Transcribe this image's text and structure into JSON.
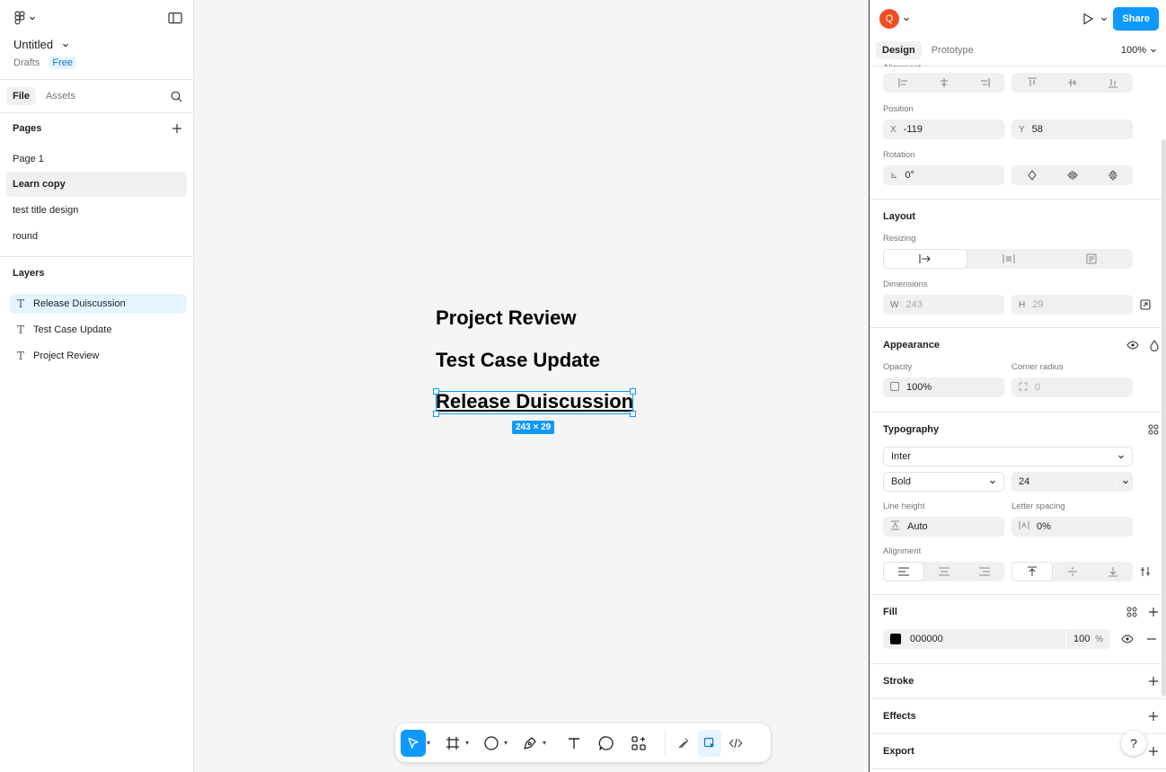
{
  "file": {
    "title": "Untitled",
    "location": "Drafts",
    "plan": "Free"
  },
  "left_tabs": {
    "file": "File",
    "assets": "Assets"
  },
  "pages": {
    "header": "Pages",
    "items": [
      "Page 1",
      "Learn copy",
      "test  title design",
      "round"
    ],
    "active": "Learn copy"
  },
  "layers": {
    "header": "Layers",
    "items": [
      "Release Duiscussion",
      "Test Case Update",
      "Project Review"
    ],
    "selected": "Release Duiscussion"
  },
  "canvas": {
    "texts": [
      "Project Review",
      "Test Case Update",
      "Release Duiscussion"
    ],
    "selection_size": "243 × 29"
  },
  "right_top": {
    "avatar": "Q",
    "share": "Share"
  },
  "right_tabs": {
    "design": "Design",
    "prototype": "Prototype",
    "zoom": "100%"
  },
  "transform": {
    "alignment_label": "Alignment",
    "position_label": "Position",
    "x_label": "X",
    "x": "-119",
    "y_label": "Y",
    "y": "58",
    "rotation_label": "Rotation",
    "rotation": "0°"
  },
  "layout": {
    "title": "Layout",
    "resizing_label": "Resizing",
    "dimensions_label": "Dimensions",
    "w_label": "W",
    "w": "243",
    "h_label": "H",
    "h": "29"
  },
  "appearance": {
    "title": "Appearance",
    "opacity_label": "Opacity",
    "opacity": "100%",
    "radius_label": "Corner radius",
    "radius": "0"
  },
  "typography": {
    "title": "Typography",
    "font": "Inter",
    "weight": "Bold",
    "size": "24",
    "line_height_label": "Line height",
    "line_height": "Auto",
    "letter_spacing_label": "Letter spacing",
    "letter_spacing": "0%",
    "alignment_label": "Alignment"
  },
  "fill": {
    "title": "Fill",
    "hex": "000000",
    "opacity": "100",
    "unit": "%",
    "swatch": "#000000"
  },
  "stroke": {
    "title": "Stroke"
  },
  "effects": {
    "title": "Effects"
  },
  "export": {
    "title": "Export"
  },
  "help": "?",
  "colors": {
    "accent": "#0d99ff",
    "avatar": "#f24e1e"
  }
}
